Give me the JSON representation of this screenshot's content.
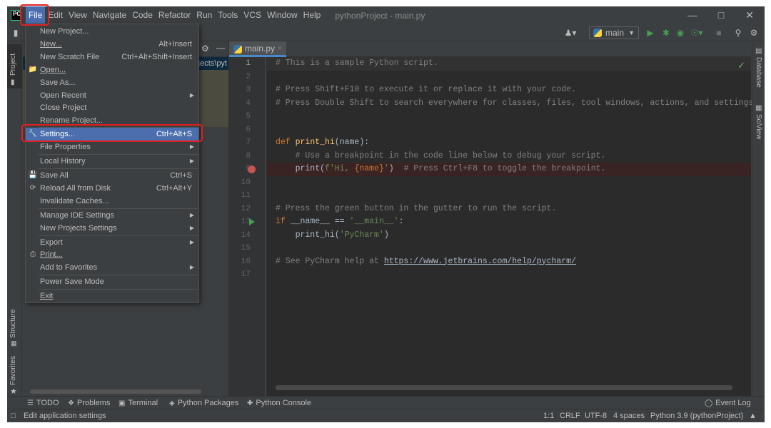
{
  "menubar": {
    "items": [
      "File",
      "Edit",
      "View",
      "Navigate",
      "Code",
      "Refactor",
      "Run",
      "Tools",
      "VCS",
      "Window",
      "Help"
    ],
    "window_title": "pythonProject - main.py",
    "logo_text": "PC"
  },
  "toolbar": {
    "run_config": "main"
  },
  "left_strip": {
    "project_tab": "Project",
    "structure_tab": "Structure",
    "favorites_tab": "Favorites"
  },
  "right_strip": {
    "database_tab": "Database",
    "sciview_tab": "SciView"
  },
  "project_panel": {
    "path_fragment": "jects\\pyt"
  },
  "editor": {
    "tab_label": "main.py",
    "line_numbers": [
      "1",
      "2",
      "3",
      "4",
      "5",
      "6",
      "7",
      "8",
      "9",
      "10",
      "11",
      "12",
      "13",
      "14",
      "15",
      "16",
      "17"
    ],
    "lines": {
      "l1": "# This is a sample Python script.",
      "l3": "# Press Shift+F10 to execute it or replace it with your code.",
      "l4": "# Press Double Shift to search everywhere for classes, files, tool windows, actions, and settings.",
      "l7_kw": "def ",
      "l7_fn": "print_hi",
      "l7_rest": "(name):",
      "l8": "    # Use a breakpoint in the code line below to debug your script.",
      "l9_a": "    print(",
      "l9_str1": "f'Hi, ",
      "l9_var": "{name}",
      "l9_str2": "'",
      "l9_b": ")  ",
      "l9_com": "# Press Ctrl+F8 to toggle the breakpoint.",
      "l12": "# Press the green button in the gutter to run the script.",
      "l13_kw": "if ",
      "l13_mid": "__name__ == ",
      "l13_str": "'__main__'",
      "l13_end": ":",
      "l14_a": "    print_hi(",
      "l14_str": "'PyCharm'",
      "l14_b": ")",
      "l16_com": "# See PyCharm help at ",
      "l16_link": "https://www.jetbrains.com/help/pycharm/"
    }
  },
  "file_menu": {
    "items": [
      {
        "label": "New Project...",
        "shortcut": ""
      },
      {
        "label": "New...",
        "shortcut": "Alt+Insert"
      },
      {
        "label": "New Scratch File",
        "shortcut": "Ctrl+Alt+Shift+Insert"
      },
      {
        "label": "Open...",
        "shortcut": ""
      },
      {
        "label": "Save As...",
        "shortcut": ""
      },
      {
        "label": "Open Recent",
        "shortcut": ""
      },
      {
        "label": "Close Project",
        "shortcut": ""
      },
      {
        "label": "Rename Project...",
        "shortcut": ""
      },
      {
        "label": "Settings...",
        "shortcut": "Ctrl+Alt+S"
      },
      {
        "label": "File Properties",
        "shortcut": ""
      },
      {
        "label": "Local History",
        "shortcut": ""
      },
      {
        "label": "Save All",
        "shortcut": "Ctrl+S"
      },
      {
        "label": "Reload All from Disk",
        "shortcut": "Ctrl+Alt+Y"
      },
      {
        "label": "Invalidate Caches...",
        "shortcut": ""
      },
      {
        "label": "Manage IDE Settings",
        "shortcut": ""
      },
      {
        "label": "New Projects Settings",
        "shortcut": ""
      },
      {
        "label": "Export",
        "shortcut": ""
      },
      {
        "label": "Print...",
        "shortcut": ""
      },
      {
        "label": "Add to Favorites",
        "shortcut": ""
      },
      {
        "label": "Power Save Mode",
        "shortcut": ""
      },
      {
        "label": "Exit",
        "shortcut": ""
      }
    ]
  },
  "bottom_tools": {
    "todo": "TODO",
    "problems": "Problems",
    "terminal": "Terminal",
    "python_packages": "Python Packages",
    "python_console": "Python Console",
    "event_log": "Event Log"
  },
  "statusbar": {
    "message": "Edit application settings",
    "position": "1:1",
    "line_sep": "CRLF",
    "encoding": "UTF-8",
    "indent": "4 spaces",
    "interpreter": "Python 3.9 (pythonProject)"
  },
  "colors": {
    "accent": "#4b6eaf",
    "annotation": "#e02020",
    "background": "#3c3f41",
    "editor_bg": "#2b2b2b"
  }
}
